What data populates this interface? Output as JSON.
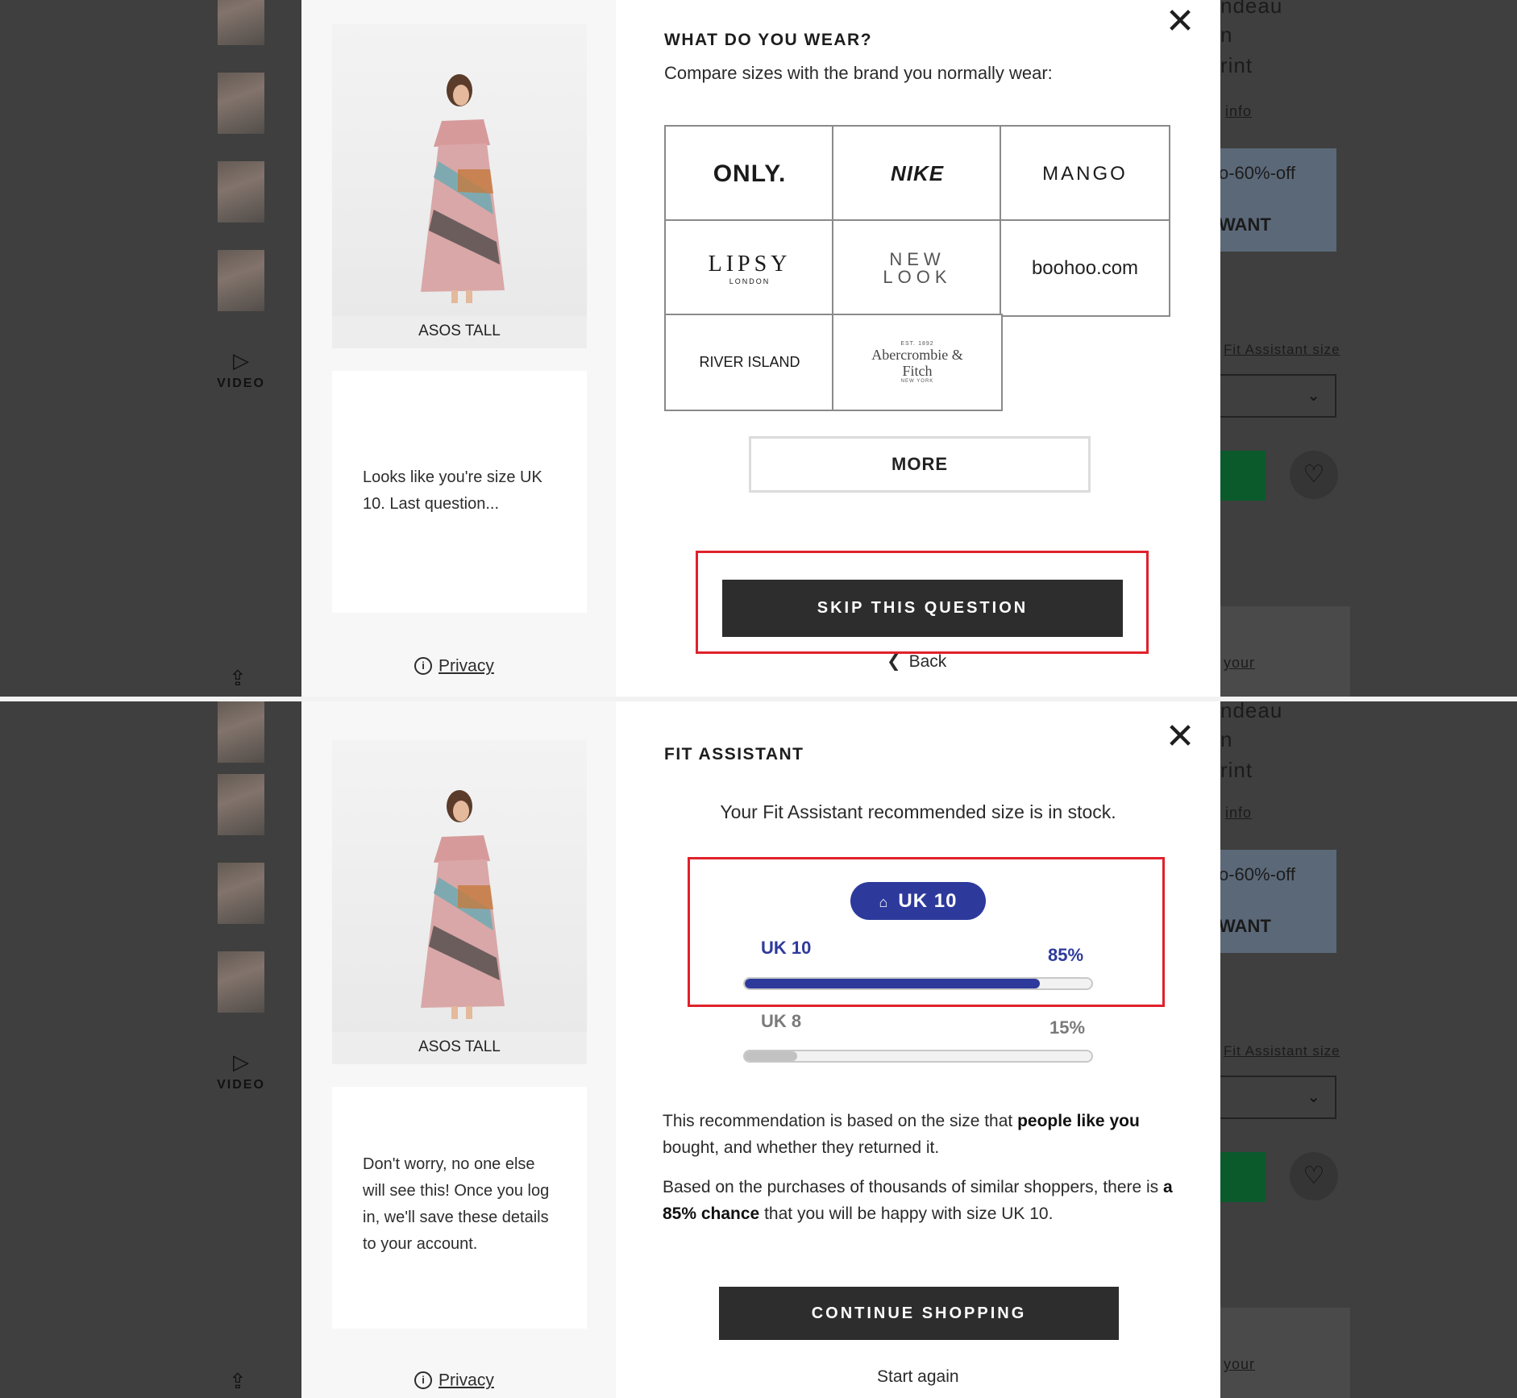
{
  "step1": {
    "product": {
      "brand_caption": "ASOS TALL"
    },
    "side_message": "Looks like you're size UK 10. Last question...",
    "privacy_label": "Privacy",
    "title": "WHAT DO YOU WEAR?",
    "subtitle": "Compare sizes with the brand you normally wear:",
    "brands": [
      "ONLY.",
      "NIKE",
      "MANGO",
      "LIPSY",
      "NEW LOOK",
      "boohoo.com",
      "RIVER ISLAND",
      "Abercrombie & Fitch"
    ],
    "brand_small": {
      "lipsy": "LONDON",
      "af_top": "EST. 1892",
      "af_bottom": "NEW YORK"
    },
    "more_label": "MORE",
    "skip_label": "SKIP THIS QUESTION",
    "back_label": "Back"
  },
  "step2": {
    "product": {
      "brand_caption": "ASOS TALL"
    },
    "side_message": "Don't worry, no one else will see this! Once you log in, we'll save these details to your account.",
    "privacy_label": "Privacy",
    "title": "FIT ASSISTANT",
    "subtitle": "Your Fit Assistant recommended size is in stock.",
    "recommended": "UK 10",
    "sizes": [
      {
        "label": "UK 10",
        "percent_text": "85%",
        "percent": 0.85
      },
      {
        "label": "UK 8",
        "percent_text": "15%",
        "percent": 0.15
      }
    ],
    "para1_pre": "This recommendation is based on the size that ",
    "para1_bold": "people like you",
    "para1_post": " bought, and whether they returned it.",
    "para2_pre": "Based on the purchases of thousands of similar shoppers, there is ",
    "para2_bold": "a 85% chance",
    "para2_post": " that you will be happy with size UK 10.",
    "continue_label": "CONTINUE SHOPPING",
    "start_again_label": "Start again"
  },
  "background": {
    "video_label": "VIDEO",
    "title_fragments": [
      "ndeau",
      "n",
      "rint"
    ],
    "info_link": "info",
    "promo_line1": "o-60%-off",
    "promo_line2": "WANT",
    "fit_link": "Fit Assistant size",
    "bottom_link": "your"
  },
  "colors": {
    "accent": "#2d3a9c",
    "highlight": "#e0212b",
    "button_dark": "#2d2d2d",
    "overlay": "#3f3f3f",
    "bar_secondary": "#c2c2c2"
  }
}
